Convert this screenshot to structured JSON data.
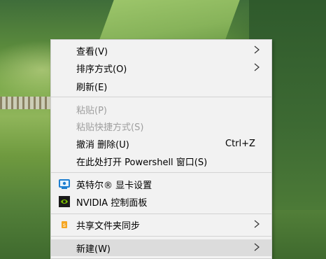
{
  "menu": {
    "items": [
      {
        "label": "查看(V)",
        "has_submenu": true
      },
      {
        "label": "排序方式(O)",
        "has_submenu": true
      },
      {
        "label": "刷新(E)"
      },
      {
        "label": "粘贴(P)",
        "disabled": true
      },
      {
        "label": "粘贴快捷方式(S)",
        "disabled": true
      },
      {
        "label": "撤消 删除(U)",
        "shortcut": "Ctrl+Z"
      },
      {
        "label": "在此处打开 Powershell 窗口(S)"
      },
      {
        "label": "英特尔® 显卡设置",
        "icon": "intel-graphics-icon"
      },
      {
        "label": "NVIDIA 控制面板",
        "icon": "nvidia-icon"
      },
      {
        "label": "共享文件夹同步",
        "icon": "share-sync-icon",
        "has_submenu": true
      },
      {
        "label": "新建(W)",
        "has_submenu": true,
        "highlighted": true
      }
    ]
  },
  "colors": {
    "menu_background": "#f2f2f2",
    "highlight": "#dcdcdc",
    "disabled_text": "#9e9e9e",
    "separator": "#d3d3d3"
  }
}
